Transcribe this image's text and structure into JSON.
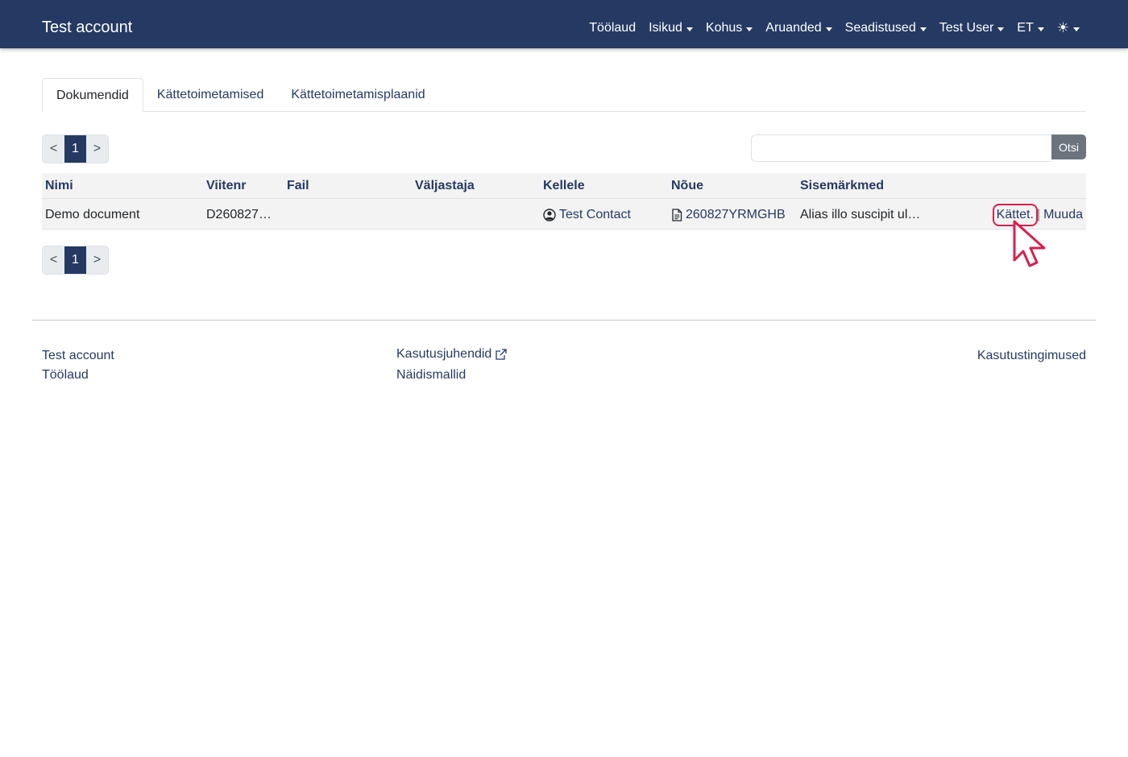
{
  "navbar": {
    "brand": "Test account",
    "items": [
      {
        "label": "Töölaud",
        "dropdown": false
      },
      {
        "label": "Isikud",
        "dropdown": true
      },
      {
        "label": "Kohus",
        "dropdown": true
      },
      {
        "label": "Aruanded",
        "dropdown": true
      },
      {
        "label": "Seadistused",
        "dropdown": true
      },
      {
        "label": "Test User",
        "dropdown": true
      },
      {
        "label": "ET",
        "dropdown": true
      }
    ],
    "theme_icon": "☀"
  },
  "tabs": [
    {
      "label": "Dokumendid",
      "active": true
    },
    {
      "label": "Kättetoimetamised",
      "active": false
    },
    {
      "label": "Kättetoimetamisplaanid",
      "active": false
    }
  ],
  "pagination": {
    "prev": "<",
    "current": "1",
    "next": ">"
  },
  "search": {
    "value": "",
    "placeholder": "",
    "button": "Otsi"
  },
  "table": {
    "columns": [
      "Nimi",
      "Viitenr",
      "Fail",
      "Väljastaja",
      "Kellele",
      "Nõue",
      "Sisemärkmed"
    ],
    "rows": [
      {
        "nimi": "Demo document",
        "viitenr": "D260827…",
        "fail": "",
        "valjastaja": "",
        "kellele": "Test Contact",
        "noue": "260827YRMGHB",
        "sisemarkmed": "Alias illo suscipit ul…",
        "action_deliver": "Kättet.",
        "action_sep": "|",
        "action_edit": "Muuda"
      }
    ]
  },
  "footer": {
    "col1": [
      "Test account",
      "Töölaud"
    ],
    "col2": [
      "Kasutusjuhendid",
      "Näidismallid"
    ],
    "col3": [
      "Kasutustingimused"
    ]
  },
  "colors": {
    "navbar": "#253a63",
    "link": "#253a63",
    "highlight": "#d6204f",
    "search_button": "#6c757d"
  }
}
